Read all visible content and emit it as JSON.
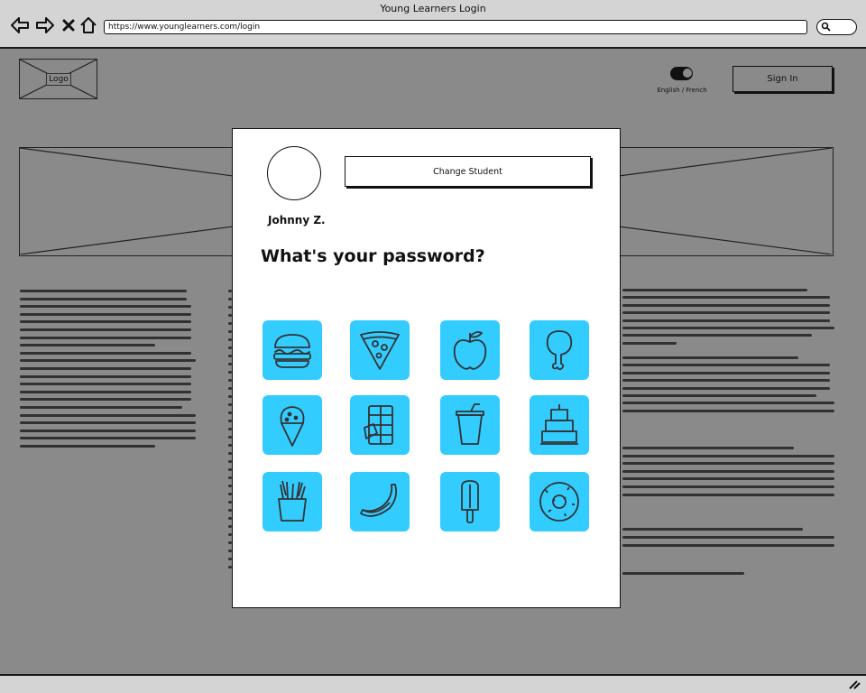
{
  "window": {
    "title": "Young Learners Login"
  },
  "address_bar": {
    "url": "https://www.younglearners.com/login"
  },
  "header": {
    "logo_label": "Logo",
    "language_label": "English / French",
    "sign_in_label": "Sign In"
  },
  "modal": {
    "student_name": "Johnny Z.",
    "change_student_label": "Change Student",
    "heading": "What's your password?",
    "icons": [
      "burger-icon",
      "pizza-icon",
      "apple-icon",
      "chicken-leg-icon",
      "ice-cream-icon",
      "chocolate-bar-icon",
      "soda-cup-icon",
      "cake-icon",
      "fries-icon",
      "banana-icon",
      "popsicle-icon",
      "donut-icon"
    ]
  },
  "colors": {
    "tile": "#33ccff",
    "overlay": "#8a8a8a",
    "chrome": "#d4d4d4"
  }
}
